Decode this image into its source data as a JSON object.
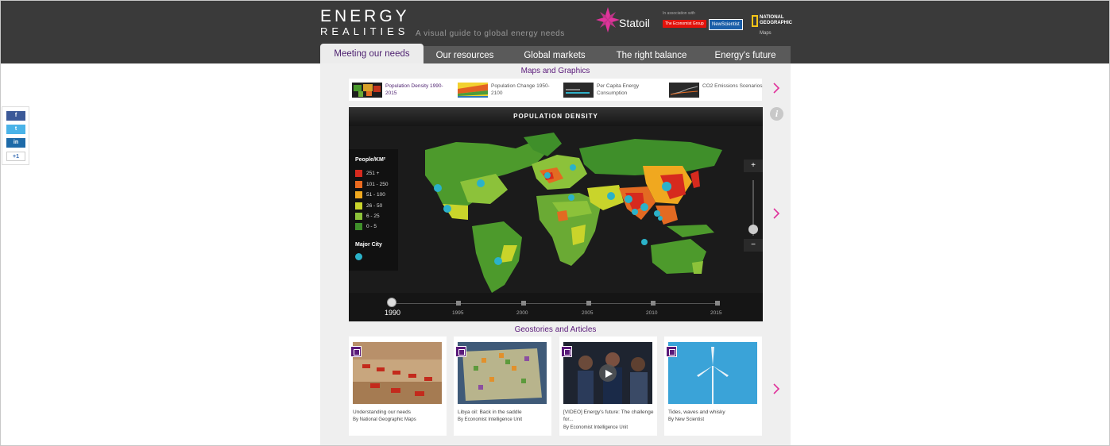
{
  "header": {
    "brand_line1": "ENERGY",
    "brand_line2": "REALITIES",
    "tagline": "A visual guide to global energy needs",
    "sponsor": "Statoil",
    "association": "In association with",
    "partners": [
      "The Economist Group",
      "NewScientist",
      "NATIONAL GEOGRAPHIC",
      "Maps"
    ]
  },
  "tabs": [
    {
      "label": "Meeting our needs",
      "active": true
    },
    {
      "label": "Our resources",
      "active": false
    },
    {
      "label": "Global markets",
      "active": false
    },
    {
      "label": "The right balance",
      "active": false
    },
    {
      "label": "Energy's future",
      "active": false
    }
  ],
  "maps_section": {
    "title": "Maps and Graphics",
    "thumbnails": [
      {
        "label": "Population Density 1990-2015",
        "active": true
      },
      {
        "label": "Population Change 1950-2100",
        "active": false
      },
      {
        "label": "Per Capita Energy Consumption",
        "active": false
      },
      {
        "label": "CO2 Emissions Scenarios",
        "active": false
      }
    ]
  },
  "map": {
    "title": "POPULATION DENSITY",
    "legend_title": "People/KM²",
    "legend": [
      {
        "label": "251 +",
        "color": "#d62a1e"
      },
      {
        "label": "101 - 250",
        "color": "#ea6a1f"
      },
      {
        "label": "51 - 100",
        "color": "#f0a81f"
      },
      {
        "label": "26 - 50",
        "color": "#c9d42b"
      },
      {
        "label": "6 - 25",
        "color": "#8cc23a"
      },
      {
        "label": "0 - 5",
        "color": "#3f8f2a"
      }
    ],
    "major_city_label": "Major City",
    "zoom_in": "+",
    "zoom_out": "−",
    "timeline": [
      "1990",
      "1995",
      "2000",
      "2005",
      "2010",
      "2015"
    ],
    "timeline_selected": "1990"
  },
  "info_icon": "i",
  "stories_section": {
    "title": "Geostories and Articles",
    "cards": [
      {
        "title": "Understanding our needs",
        "by": "By National Geographic Maps"
      },
      {
        "title": "Libya oil: Back in the saddle",
        "by": "By Economist Intelligence Unit"
      },
      {
        "title": "[VIDEO] Energy's future: The challenge for...",
        "by": "By Economist Intelligence Unit"
      },
      {
        "title": "Tides, waves and whisky",
        "by": "By New Scientist"
      }
    ]
  },
  "social": [
    "f",
    "t",
    "in",
    "+1"
  ],
  "colors": {
    "accent": "#5a1a7a",
    "arrow": "#e0339b",
    "topbar": "#3a3a3a",
    "city": "#2bb2c9"
  }
}
